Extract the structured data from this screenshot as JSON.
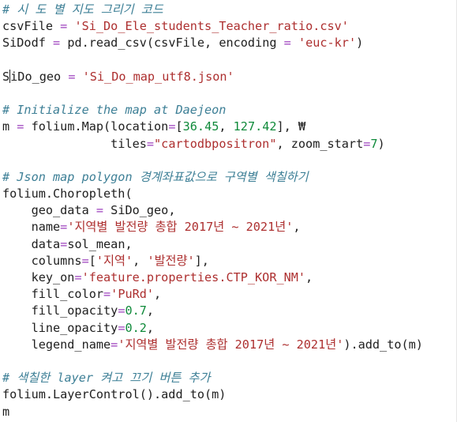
{
  "lines": [
    {
      "type": "comment",
      "text": "# 시 도 별 지도 그리기 코드"
    },
    {
      "type": "code",
      "parts": [
        {
          "k": "txt",
          "t": "csvFile "
        },
        {
          "k": "op",
          "t": "="
        },
        {
          "k": "txt",
          "t": " "
        },
        {
          "k": "str",
          "t": "'Si_Do_Ele_students_Teacher_ratio.csv'"
        }
      ]
    },
    {
      "type": "code",
      "parts": [
        {
          "k": "txt",
          "t": "SiDodf "
        },
        {
          "k": "op",
          "t": "="
        },
        {
          "k": "txt",
          "t": " pd.read_csv(csvFile, encoding "
        },
        {
          "k": "op",
          "t": "="
        },
        {
          "k": "txt",
          "t": " "
        },
        {
          "k": "str",
          "t": "'euc-kr'"
        },
        {
          "k": "txt",
          "t": ")"
        }
      ]
    },
    {
      "type": "blank"
    },
    {
      "type": "cursorline",
      "before": "S",
      "after": "iDo_geo ",
      "eq": "=",
      "str": "'Si_Do_map_utf8.json'"
    },
    {
      "type": "blank"
    },
    {
      "type": "comment",
      "text": "# Initialize the map at Daejeon"
    },
    {
      "type": "code",
      "parts": [
        {
          "k": "txt",
          "t": "m "
        },
        {
          "k": "op",
          "t": "="
        },
        {
          "k": "txt",
          "t": " folium.Map(location"
        },
        {
          "k": "op",
          "t": "="
        },
        {
          "k": "txt",
          "t": "["
        },
        {
          "k": "num",
          "t": "36.45"
        },
        {
          "k": "txt",
          "t": ", "
        },
        {
          "k": "num",
          "t": "127.42"
        },
        {
          "k": "txt",
          "t": "], ₩"
        }
      ]
    },
    {
      "type": "code",
      "parts": [
        {
          "k": "txt",
          "t": "               tiles"
        },
        {
          "k": "op",
          "t": "="
        },
        {
          "k": "str",
          "t": "\"cartodbpositron\""
        },
        {
          "k": "txt",
          "t": ", zoom_start"
        },
        {
          "k": "op",
          "t": "="
        },
        {
          "k": "num",
          "t": "7"
        },
        {
          "k": "txt",
          "t": ")"
        }
      ]
    },
    {
      "type": "blank"
    },
    {
      "type": "comment",
      "text": "# Json map polygon 경계좌표값으로 구역별 색칠하기"
    },
    {
      "type": "code",
      "parts": [
        {
          "k": "txt",
          "t": "folium.Choropleth("
        }
      ]
    },
    {
      "type": "code",
      "parts": [
        {
          "k": "txt",
          "t": "    geo_data "
        },
        {
          "k": "op",
          "t": "="
        },
        {
          "k": "txt",
          "t": " SiDo_geo,"
        }
      ]
    },
    {
      "type": "code",
      "parts": [
        {
          "k": "txt",
          "t": "    name"
        },
        {
          "k": "op",
          "t": "="
        },
        {
          "k": "str",
          "t": "'지역별 발전량 총합 2017년 ~ 2021년'"
        },
        {
          "k": "txt",
          "t": ","
        }
      ]
    },
    {
      "type": "code",
      "parts": [
        {
          "k": "txt",
          "t": "    data"
        },
        {
          "k": "op",
          "t": "="
        },
        {
          "k": "txt",
          "t": "sol_mean,"
        }
      ]
    },
    {
      "type": "code",
      "parts": [
        {
          "k": "txt",
          "t": "    columns"
        },
        {
          "k": "op",
          "t": "="
        },
        {
          "k": "txt",
          "t": "["
        },
        {
          "k": "str",
          "t": "'지역'"
        },
        {
          "k": "txt",
          "t": ", "
        },
        {
          "k": "str",
          "t": "'발전량'"
        },
        {
          "k": "txt",
          "t": "],"
        }
      ]
    },
    {
      "type": "code",
      "parts": [
        {
          "k": "txt",
          "t": "    key_on"
        },
        {
          "k": "op",
          "t": "="
        },
        {
          "k": "str",
          "t": "'feature.properties.CTP_KOR_NM'"
        },
        {
          "k": "txt",
          "t": ","
        }
      ]
    },
    {
      "type": "code",
      "parts": [
        {
          "k": "txt",
          "t": "    fill_color"
        },
        {
          "k": "op",
          "t": "="
        },
        {
          "k": "str",
          "t": "'PuRd'"
        },
        {
          "k": "txt",
          "t": ","
        }
      ]
    },
    {
      "type": "code",
      "parts": [
        {
          "k": "txt",
          "t": "    fill_opacity"
        },
        {
          "k": "op",
          "t": "="
        },
        {
          "k": "num",
          "t": "0.7"
        },
        {
          "k": "txt",
          "t": ","
        }
      ]
    },
    {
      "type": "code",
      "parts": [
        {
          "k": "txt",
          "t": "    line_opacity"
        },
        {
          "k": "op",
          "t": "="
        },
        {
          "k": "num",
          "t": "0.2"
        },
        {
          "k": "txt",
          "t": ","
        }
      ]
    },
    {
      "type": "code",
      "parts": [
        {
          "k": "txt",
          "t": "    legend_name"
        },
        {
          "k": "op",
          "t": "="
        },
        {
          "k": "str",
          "t": "'지역별 발전량 총합 2017년 ~ 2021년'"
        },
        {
          "k": "txt",
          "t": ").add_to(m)"
        }
      ]
    },
    {
      "type": "blank"
    },
    {
      "type": "comment",
      "text": "# 색칠한 layer 켜고 끄기 버튼 추가"
    },
    {
      "type": "code",
      "parts": [
        {
          "k": "txt",
          "t": "folium.LayerControl().add_to(m)"
        }
      ]
    },
    {
      "type": "code",
      "parts": [
        {
          "k": "txt",
          "t": "m"
        }
      ]
    }
  ]
}
